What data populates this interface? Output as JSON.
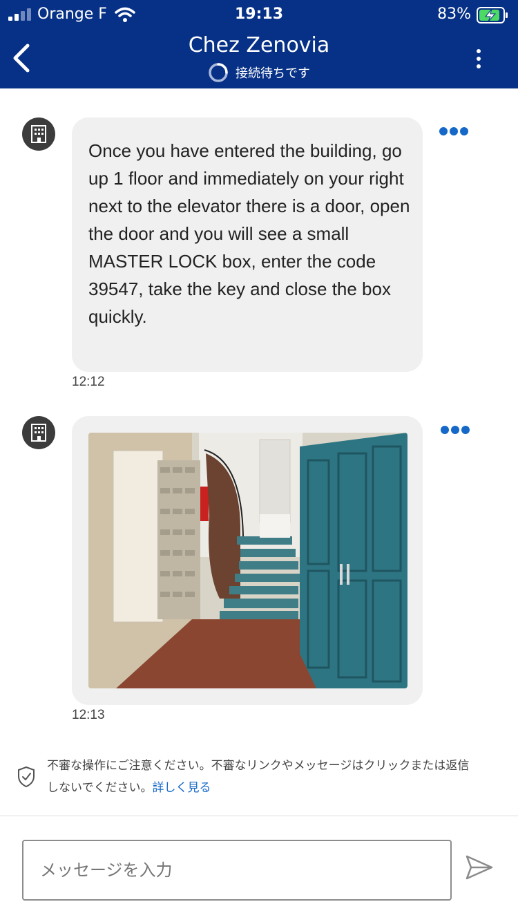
{
  "status_bar": {
    "carrier": "Orange F",
    "time": "19:13",
    "battery": "83%",
    "icons": [
      "signal-icon",
      "wifi-icon",
      "battery-charging-icon"
    ]
  },
  "header": {
    "title": "Chez Zenovia",
    "connection_status": "接続待ちです",
    "icons": [
      "back-icon",
      "loading-spinner-icon",
      "more-vertical-icon"
    ],
    "background_color": "#073186"
  },
  "messages": [
    {
      "sender_icon": "building-icon",
      "text": "Once you have entered the building, go up 1 floor and immediately on your right next to the elevator there is a door, open the door and you will see a small MASTER LOCK box, enter the code 39547, take the key and close the box quickly.",
      "time": "12:12"
    },
    {
      "sender_icon": "building-icon",
      "image": "photo of building entrance hallway with mailboxes, spiral staircase and blue doors",
      "time": "12:13"
    }
  ],
  "warning": {
    "text": "不審な操作にご注意ください。不審なリンクやメッセージはクリックまたは返信しないでください。",
    "link_label": "詳しく見る",
    "icon": "shield-check-icon"
  },
  "composer": {
    "placeholder": "メッセージを入力",
    "send_icon": "send-icon"
  },
  "colors": {
    "accent": "#1568c8",
    "bubble": "#f0f0f0"
  }
}
